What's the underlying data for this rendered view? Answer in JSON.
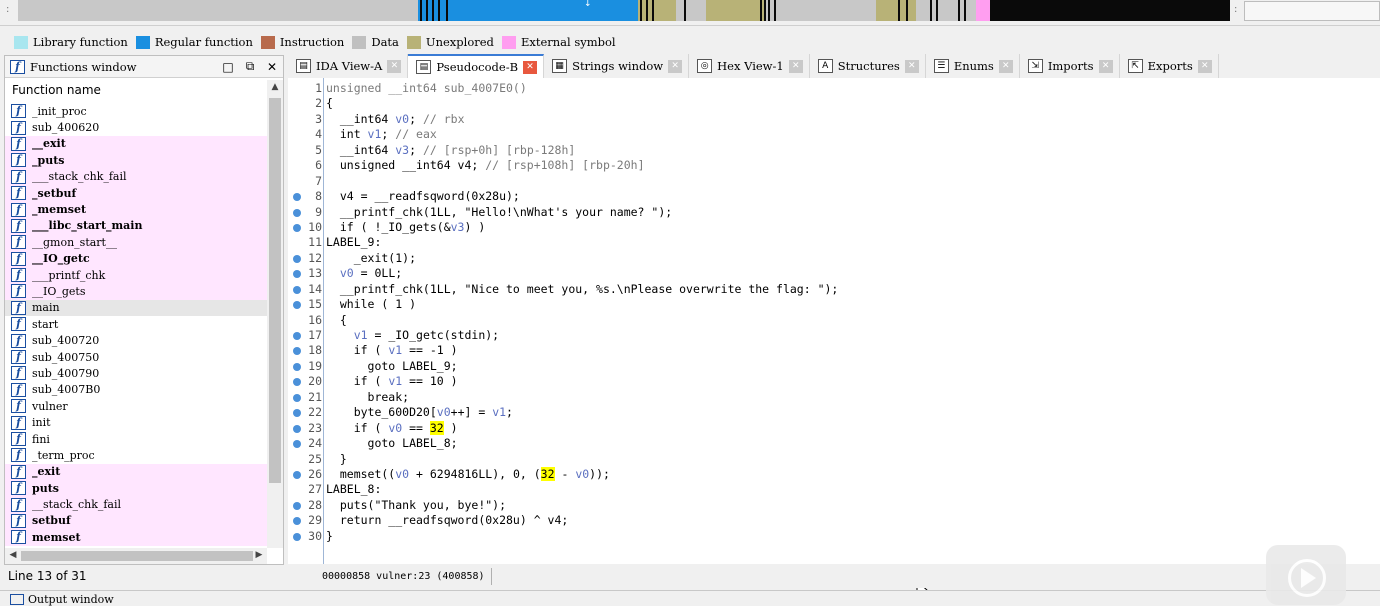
{
  "legend": [
    {
      "label": "Library function",
      "color": "#a8e6ef"
    },
    {
      "label": "Regular function",
      "color": "#1a8fe0"
    },
    {
      "label": "Instruction",
      "color": "#b86a4c"
    },
    {
      "label": "Data",
      "color": "#c0c0c0"
    },
    {
      "label": "Unexplored",
      "color": "#b8b277"
    },
    {
      "label": "External symbol",
      "color": "#ff9ef0"
    }
  ],
  "functions_window": {
    "title": "Functions window",
    "column_header": "Function name",
    "items": [
      {
        "name": "_init_proc",
        "bold": false,
        "pink": false
      },
      {
        "name": "sub_400620",
        "bold": false,
        "pink": false
      },
      {
        "name": "__exit",
        "bold": true,
        "pink": true
      },
      {
        "name": "_puts",
        "bold": true,
        "pink": true
      },
      {
        "name": "___stack_chk_fail",
        "bold": false,
        "pink": true
      },
      {
        "name": "_setbuf",
        "bold": true,
        "pink": true
      },
      {
        "name": "_memset",
        "bold": true,
        "pink": true
      },
      {
        "name": "___libc_start_main",
        "bold": true,
        "pink": true
      },
      {
        "name": "__gmon_start__",
        "bold": false,
        "pink": true
      },
      {
        "name": "__IO_getc",
        "bold": true,
        "pink": true
      },
      {
        "name": "___printf_chk",
        "bold": false,
        "pink": true
      },
      {
        "name": "__IO_gets",
        "bold": false,
        "pink": true
      },
      {
        "name": "main",
        "bold": false,
        "pink": false,
        "selected": true
      },
      {
        "name": "start",
        "bold": false,
        "pink": false
      },
      {
        "name": "sub_400720",
        "bold": false,
        "pink": false
      },
      {
        "name": "sub_400750",
        "bold": false,
        "pink": false
      },
      {
        "name": "sub_400790",
        "bold": false,
        "pink": false
      },
      {
        "name": "sub_4007B0",
        "bold": false,
        "pink": false
      },
      {
        "name": "vulner",
        "bold": false,
        "pink": false
      },
      {
        "name": "init",
        "bold": false,
        "pink": false
      },
      {
        "name": "fini",
        "bold": false,
        "pink": false
      },
      {
        "name": "_term_proc",
        "bold": false,
        "pink": false
      },
      {
        "name": "_exit",
        "bold": true,
        "pink": true
      },
      {
        "name": "puts",
        "bold": true,
        "pink": true
      },
      {
        "name": "__stack_chk_fail",
        "bold": false,
        "pink": true
      },
      {
        "name": "setbuf",
        "bold": true,
        "pink": true
      },
      {
        "name": "memset",
        "bold": true,
        "pink": true
      }
    ],
    "line_info": "Line 13 of 31"
  },
  "tabs": [
    {
      "label": "IDA View-A",
      "icon": "ida-view-icon",
      "active": false
    },
    {
      "label": "Pseudocode-B",
      "icon": "pseudocode-icon",
      "active": true
    },
    {
      "label": "Strings window",
      "icon": "strings-icon",
      "active": false
    },
    {
      "label": "Hex View-1",
      "icon": "hex-icon",
      "active": false
    },
    {
      "label": "Structures",
      "icon": "structures-icon",
      "active": false
    },
    {
      "label": "Enums",
      "icon": "enums-icon",
      "active": false
    },
    {
      "label": "Imports",
      "icon": "imports-icon",
      "active": false
    },
    {
      "label": "Exports",
      "icon": "exports-icon",
      "active": false
    }
  ],
  "code_lines": [
    {
      "n": "1",
      "dot": false,
      "t": "unsigned __int64 sub_4007E0()"
    },
    {
      "n": "2",
      "dot": false,
      "t": "{"
    },
    {
      "n": "3",
      "dot": false,
      "t": "  __int64 v0; // rbx"
    },
    {
      "n": "4",
      "dot": false,
      "t": "  int v1; // eax"
    },
    {
      "n": "5",
      "dot": false,
      "t": "  __int64 v3; // [rsp+0h] [rbp-128h]"
    },
    {
      "n": "6",
      "dot": false,
      "t": "  unsigned __int64 v4; // [rsp+108h] [rbp-20h]"
    },
    {
      "n": "7",
      "dot": false,
      "t": ""
    },
    {
      "n": "8",
      "dot": true,
      "t": "  v4 = __readfsqword(0x28u);"
    },
    {
      "n": "9",
      "dot": true,
      "t": "  __printf_chk(1LL, \"Hello!\\nWhat's your name? \");"
    },
    {
      "n": "10",
      "dot": true,
      "t": "  if ( !_IO_gets(&v3) )"
    },
    {
      "n": "11",
      "dot": false,
      "t": "LABEL_9:"
    },
    {
      "n": "12",
      "dot": true,
      "t": "    _exit(1);"
    },
    {
      "n": "13",
      "dot": true,
      "t": "  v0 = 0LL;"
    },
    {
      "n": "14",
      "dot": true,
      "t": "  __printf_chk(1LL, \"Nice to meet you, %s.\\nPlease overwrite the flag: \");"
    },
    {
      "n": "15",
      "dot": true,
      "t": "  while ( 1 )"
    },
    {
      "n": "16",
      "dot": false,
      "t": "  {"
    },
    {
      "n": "17",
      "dot": true,
      "t": "    v1 = _IO_getc(stdin);"
    },
    {
      "n": "18",
      "dot": true,
      "t": "    if ( v1 == -1 )"
    },
    {
      "n": "19",
      "dot": true,
      "t": "      goto LABEL_9;"
    },
    {
      "n": "20",
      "dot": true,
      "t": "    if ( v1 == 10 )"
    },
    {
      "n": "21",
      "dot": true,
      "t": "      break;"
    },
    {
      "n": "22",
      "dot": true,
      "t": "    byte_600D20[v0++] = v1;"
    },
    {
      "n": "23",
      "dot": true,
      "t": "    if ( v0 == 32 )"
    },
    {
      "n": "24",
      "dot": true,
      "t": "      goto LABEL_8;"
    },
    {
      "n": "25",
      "dot": false,
      "t": "  }"
    },
    {
      "n": "26",
      "dot": true,
      "t": "  memset((v0 + 6294816LL), 0, (32 - v0));"
    },
    {
      "n": "27",
      "dot": false,
      "t": "LABEL_8:"
    },
    {
      "n": "28",
      "dot": true,
      "t": "  puts(\"Thank you, bye!\");"
    },
    {
      "n": "29",
      "dot": true,
      "t": "  return __readfsqword(0x28u) ^ v4;"
    },
    {
      "n": "30",
      "dot": true,
      "t": "}"
    }
  ],
  "status": {
    "address_text": "00000858 vulner:23 (400858)"
  },
  "output_window": {
    "title": "Output window"
  }
}
